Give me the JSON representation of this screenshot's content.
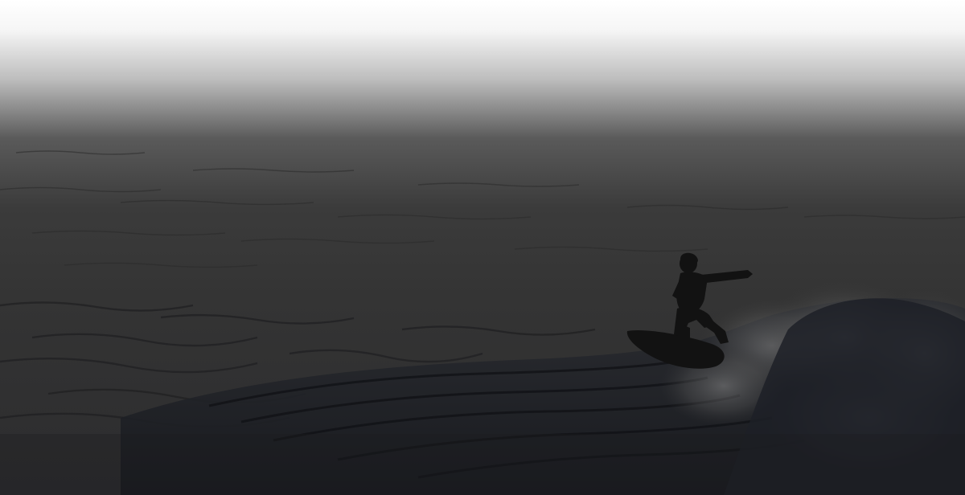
{
  "scene": {
    "subject": "surfer-silhouette",
    "setting": "ocean-wave",
    "colors": {
      "sky_top": "#ffffff",
      "haze": "#5a5a5a",
      "sea_far": "#343434",
      "sea_near": "#2c2c2e",
      "wave_dark": "#1a1c22",
      "spray": "#6f6f6f",
      "silhouette": "#121212"
    }
  }
}
